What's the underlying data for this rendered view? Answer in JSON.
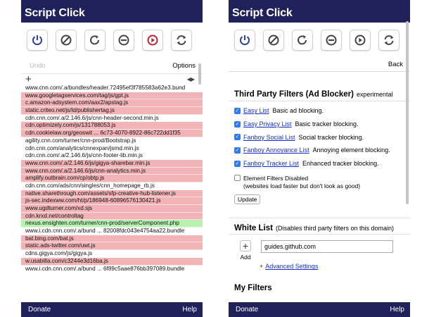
{
  "app": {
    "title": "Script Click",
    "footer": {
      "donate": "Donate",
      "help": "Help"
    }
  },
  "colors": {
    "header_bg": "#20205a",
    "icon_blue": "#2a3f9e",
    "icon_gray": "#444444",
    "icon_red": "#c02030",
    "blocked_bg": "#f3b4b7",
    "allowed_bg": "#b8f2b0",
    "link": "#1530c8"
  },
  "toolbar": {
    "buttons": [
      {
        "name": "power",
        "icon": "power-icon"
      },
      {
        "name": "block",
        "icon": "no-entry-icon"
      },
      {
        "name": "reload",
        "icon": "reload-icon"
      },
      {
        "name": "minus",
        "icon": "minus-circle-icon"
      },
      {
        "name": "play",
        "icon": "play-circle-icon"
      },
      {
        "name": "sync",
        "icon": "sync-icon"
      }
    ]
  },
  "left": {
    "undo_label": "Undo",
    "options_label": "Options",
    "add_symbol": "+",
    "arrows": "◀▶",
    "urls": [
      {
        "text": "www.cnn.com/.a/bundles/header.72495ef3f785583a62e3.bund",
        "state": "neutral"
      },
      {
        "text": "www.googletagservices.com/tag/js/gpt.js",
        "state": "blocked"
      },
      {
        "text": "c.amazon-adsystem.com/aax2/apstag.js",
        "state": "blocked"
      },
      {
        "text": "static.criteo.net/js/ld/publishertag.js",
        "state": "blocked"
      },
      {
        "text": "cdn.cnn.com/.a/2.146.6/js/cnn-header-second.min.js",
        "state": "neutral"
      },
      {
        "text": "cdn.optimizely.com/js/131788053.js",
        "state": "blocked"
      },
      {
        "text": "cdn.cookielaw.org/geoswit ... 6c73-4070-8922-86c722dd1f35",
        "state": "blocked"
      },
      {
        "text": "agility.cnn.com/turner/cnn-prod/Bootstrap.js",
        "state": "neutral"
      },
      {
        "text": "cdn.cnn.com/analytics/cnnexpan/jsmd.min.js",
        "state": "neutral"
      },
      {
        "text": "cdn.cnn.com/.a/2.146.6/js/cnn-footer-lib.min.js",
        "state": "neutral"
      },
      {
        "text": "www.cnn.com/.a/2.146.6/js/gigya-sharebar.min.js",
        "state": "blocked"
      },
      {
        "text": "www.cnn.com/.a/2.146.6/js/cnn-analytics.min.js",
        "state": "blocked"
      },
      {
        "text": "amplify.outbrain.com/cp/obtp.js",
        "state": "blocked"
      },
      {
        "text": "cdn.cnn.com/ads/cnn/singles/cnn_homepage_rb.js",
        "state": "neutral"
      },
      {
        "text": "native.sharethrough.com/assets/sfp-creative-hub-listener.js",
        "state": "blocked"
      },
      {
        "text": "js-sec.indexww.com/ht/p/186948-60896576130421.js",
        "state": "blocked"
      },
      {
        "text": "www.ugdturner.com/xd.sjs",
        "state": "blocked"
      },
      {
        "text": "cdn.krxd.net/controltag",
        "state": "blocked"
      },
      {
        "text": "nexus.ensighten.com/turner/cnn-prod/serverComponent.php",
        "state": "allowed"
      },
      {
        "text": "www.i.cdn.cnn.com/.a/bund ... 82008fdc043e4754aa22.bundle",
        "state": "neutral"
      },
      {
        "text": "bat.bing.com/bat.js",
        "state": "blocked"
      },
      {
        "text": "static.ads-twitter.com/uwt.js",
        "state": "blocked"
      },
      {
        "text": "cdns.gigya.com/js/gigya.js",
        "state": "neutral"
      },
      {
        "text": "w.usabilla.com/c3244e3d16ba.js",
        "state": "blocked"
      },
      {
        "text": "www.i.cdn.cnn.com/.a/bund ... 6f89c5aae876bb397089.bundle",
        "state": "neutral"
      }
    ]
  },
  "right": {
    "back_label": "Back",
    "third_party": {
      "title": "Third Party Filters (Ad Blocker)",
      "subtitle": "experimental",
      "filters": [
        {
          "link": "Easy List",
          "desc": "Basic ad blocking.",
          "checked": true
        },
        {
          "link": "Easy Privacy List",
          "desc": "Basic tracker blocking.",
          "checked": true
        },
        {
          "link": "Fanboy Social List",
          "desc": "Social tracker blocking.",
          "checked": true
        },
        {
          "link": "Fanboy Annoyance List",
          "desc": "Annoying element blocking.",
          "checked": true
        },
        {
          "link": "Fanboy Tracker List",
          "desc": "Enhanced tracker blocking.",
          "checked": true
        }
      ],
      "element_filters_label": "Element Filters Disabled",
      "element_filters_note": "(websites load faster but don't look as good)",
      "update_label": "Update"
    },
    "whitelist": {
      "title": "White List",
      "subtitle": "(Disables third party filters on this domain)",
      "add_label": "Add",
      "add_symbol": "+",
      "domain_value": "guides.github.com",
      "advanced_label": "Advanced Settings"
    },
    "my_filters_title": "My Filters"
  }
}
